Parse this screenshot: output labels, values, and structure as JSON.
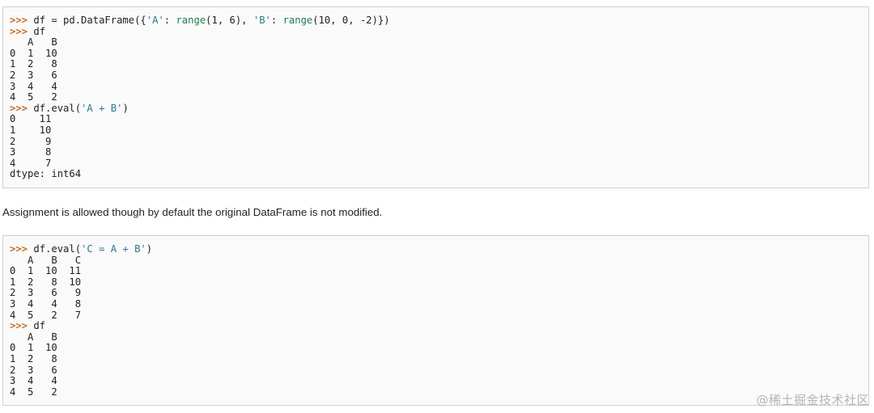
{
  "colors": {
    "prompt": "#cc6c1f",
    "string": "#2a7a8c",
    "number": "#208050",
    "text": "#222222",
    "code_background": "#fafafa",
    "code_border": "#d0d0d0"
  },
  "block1": {
    "lines": [
      [
        {
          "t": ">>>",
          "c": "prompt"
        },
        {
          "t": " df = pd.DataFrame({"
        },
        {
          "t": "'A'",
          "c": "str"
        },
        {
          "t": ": "
        },
        {
          "t": "range",
          "c": "num"
        },
        {
          "t": "(1, 6), "
        },
        {
          "t": "'B'",
          "c": "str"
        },
        {
          "t": ": "
        },
        {
          "t": "range",
          "c": "num"
        },
        {
          "t": "(10, 0, -2)})"
        }
      ],
      [
        {
          "t": ">>>",
          "c": "prompt"
        },
        {
          "t": " df"
        }
      ],
      [
        {
          "t": "   A   B"
        }
      ],
      [
        {
          "t": "0  1  10"
        }
      ],
      [
        {
          "t": "1  2   8"
        }
      ],
      [
        {
          "t": "2  3   6"
        }
      ],
      [
        {
          "t": "3  4   4"
        }
      ],
      [
        {
          "t": "4  5   2"
        }
      ],
      [
        {
          "t": ">>>",
          "c": "prompt"
        },
        {
          "t": " df.eval("
        },
        {
          "t": "'A + B'",
          "c": "str"
        },
        {
          "t": ")"
        }
      ],
      [
        {
          "t": "0    11"
        }
      ],
      [
        {
          "t": "1    10"
        }
      ],
      [
        {
          "t": "2     9"
        }
      ],
      [
        {
          "t": "3     8"
        }
      ],
      [
        {
          "t": "4     7"
        }
      ],
      [
        {
          "t": "dtype: int64"
        }
      ]
    ]
  },
  "prose": "Assignment is allowed though by default the original DataFrame is not modified.",
  "block2": {
    "lines": [
      [
        {
          "t": ">>>",
          "c": "prompt"
        },
        {
          "t": " df.eval("
        },
        {
          "t": "'C = A + B'",
          "c": "str"
        },
        {
          "t": ")"
        }
      ],
      [
        {
          "t": "   A   B   C"
        }
      ],
      [
        {
          "t": "0  1  10  11"
        }
      ],
      [
        {
          "t": "1  2   8  10"
        }
      ],
      [
        {
          "t": "2  3   6   9"
        }
      ],
      [
        {
          "t": "3  4   4   8"
        }
      ],
      [
        {
          "t": "4  5   2   7"
        }
      ],
      [
        {
          "t": ">>>",
          "c": "prompt"
        },
        {
          "t": " df"
        }
      ],
      [
        {
          "t": "   A   B"
        }
      ],
      [
        {
          "t": "0  1  10"
        }
      ],
      [
        {
          "t": "1  2   8"
        }
      ],
      [
        {
          "t": "2  3   6"
        }
      ],
      [
        {
          "t": "3  4   4"
        }
      ],
      [
        {
          "t": "4  5   2"
        }
      ]
    ]
  },
  "watermark": "@稀土掘金技术社区"
}
